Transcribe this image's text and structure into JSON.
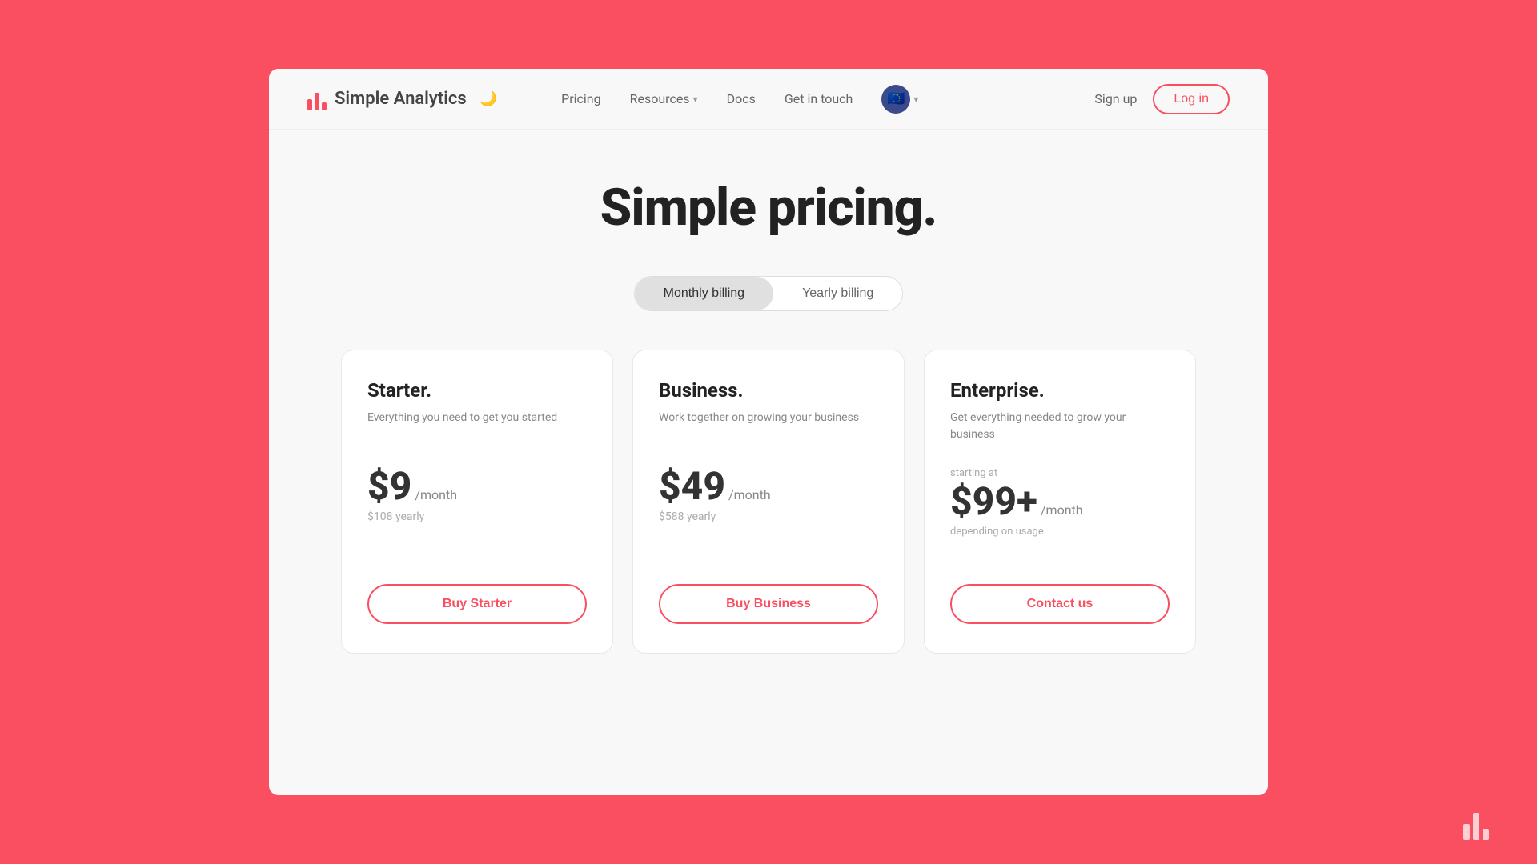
{
  "brand": {
    "name": "Simple Analytics",
    "icon_alt": "bar chart icon"
  },
  "nav": {
    "pricing_label": "Pricing",
    "resources_label": "Resources",
    "docs_label": "Docs",
    "get_in_touch_label": "Get in touch",
    "sign_up_label": "Sign up",
    "login_label": "Log in"
  },
  "hero": {
    "title": "Simple pricing."
  },
  "billing": {
    "monthly_label": "Monthly billing",
    "yearly_label": "Yearly billing",
    "active": "monthly"
  },
  "plans": [
    {
      "name": "Starter.",
      "description": "Everything you need to get you started",
      "starting_at": "",
      "price": "$9",
      "period": "/month",
      "yearly": "$108 yearly",
      "depending": "",
      "cta": "Buy Starter"
    },
    {
      "name": "Business.",
      "description": "Work together on growing your business",
      "starting_at": "",
      "price": "$49",
      "period": "/month",
      "yearly": "$588 yearly",
      "depending": "",
      "cta": "Buy Business"
    },
    {
      "name": "Enterprise.",
      "description": "Get everything needed to grow your business",
      "starting_at": "starting at",
      "price": "$99+",
      "period": "/month",
      "yearly": "",
      "depending": "depending on usage",
      "cta": "Contact us"
    }
  ]
}
